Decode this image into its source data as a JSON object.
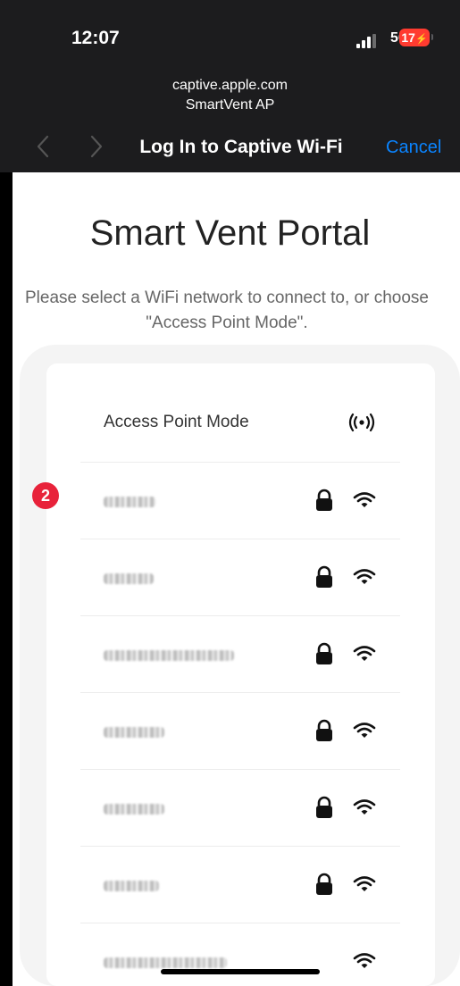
{
  "status_bar": {
    "time": "12:07",
    "network": "5G",
    "battery": "17"
  },
  "browser": {
    "url": "captive.apple.com",
    "ssid": "SmartVent AP",
    "title": "Log In to Captive Wi-Fi",
    "cancel_label": "Cancel"
  },
  "page": {
    "heading": "Smart Vent Portal",
    "subtitle": "Please select a WiFi network to connect to, or choose \"Access Point Mode\".",
    "badge": "2"
  },
  "networks": [
    {
      "label": "Access Point Mode",
      "icon": "access-point-icon"
    },
    {
      "label": "",
      "secured": true,
      "icon": "wifi-icon"
    },
    {
      "label": "",
      "secured": true,
      "icon": "wifi-icon"
    },
    {
      "label": "",
      "secured": true,
      "icon": "wifi-icon"
    },
    {
      "label": "",
      "secured": true,
      "icon": "wifi-icon"
    },
    {
      "label": "",
      "secured": true,
      "icon": "wifi-icon"
    },
    {
      "label": "",
      "secured": true,
      "icon": "wifi-icon"
    },
    {
      "label": "",
      "secured": false,
      "icon": "wifi-icon"
    }
  ],
  "colors": {
    "chrome": "#1c1c1e",
    "accent": "#0a84ff",
    "badge": "#e8223a",
    "battery": "#ff3b30"
  }
}
